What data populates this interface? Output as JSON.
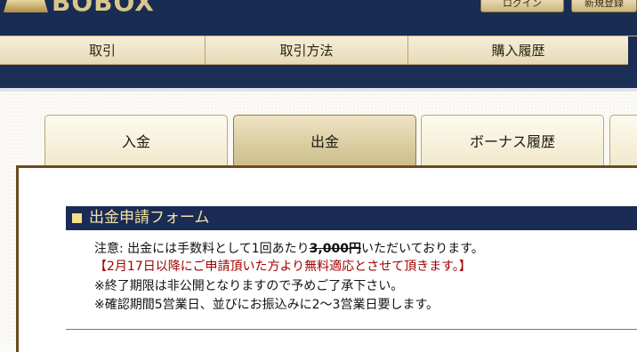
{
  "header": {
    "logo_text": "BOBOX",
    "buttons": [
      "ログイン",
      "新規登録"
    ]
  },
  "nav": {
    "items": [
      "取引",
      "取引方法",
      "購入履歴"
    ]
  },
  "tabs": {
    "items": [
      "入金",
      "出金",
      "ボーナス履歴",
      ""
    ],
    "active_index": 1
  },
  "form": {
    "title": "出金申請フォーム",
    "notice_prefix": "注意: 出金には手数料として1回あたり",
    "fee": "3,000円",
    "notice_suffix": "いただいております。",
    "free_notice": "【2月17日以降にご申請頂いた方より無料適応とさせて頂きます。】",
    "deadline_note": "※終了期限は非公開となりますので予めご了承下さい。",
    "processing_note": "※確認期間5営業日、並びにお振込みに2～3営業日要します。"
  },
  "colors": {
    "navy": "#1a2b55",
    "gold": "#f2e4a6",
    "warning_red": "#a30000"
  }
}
